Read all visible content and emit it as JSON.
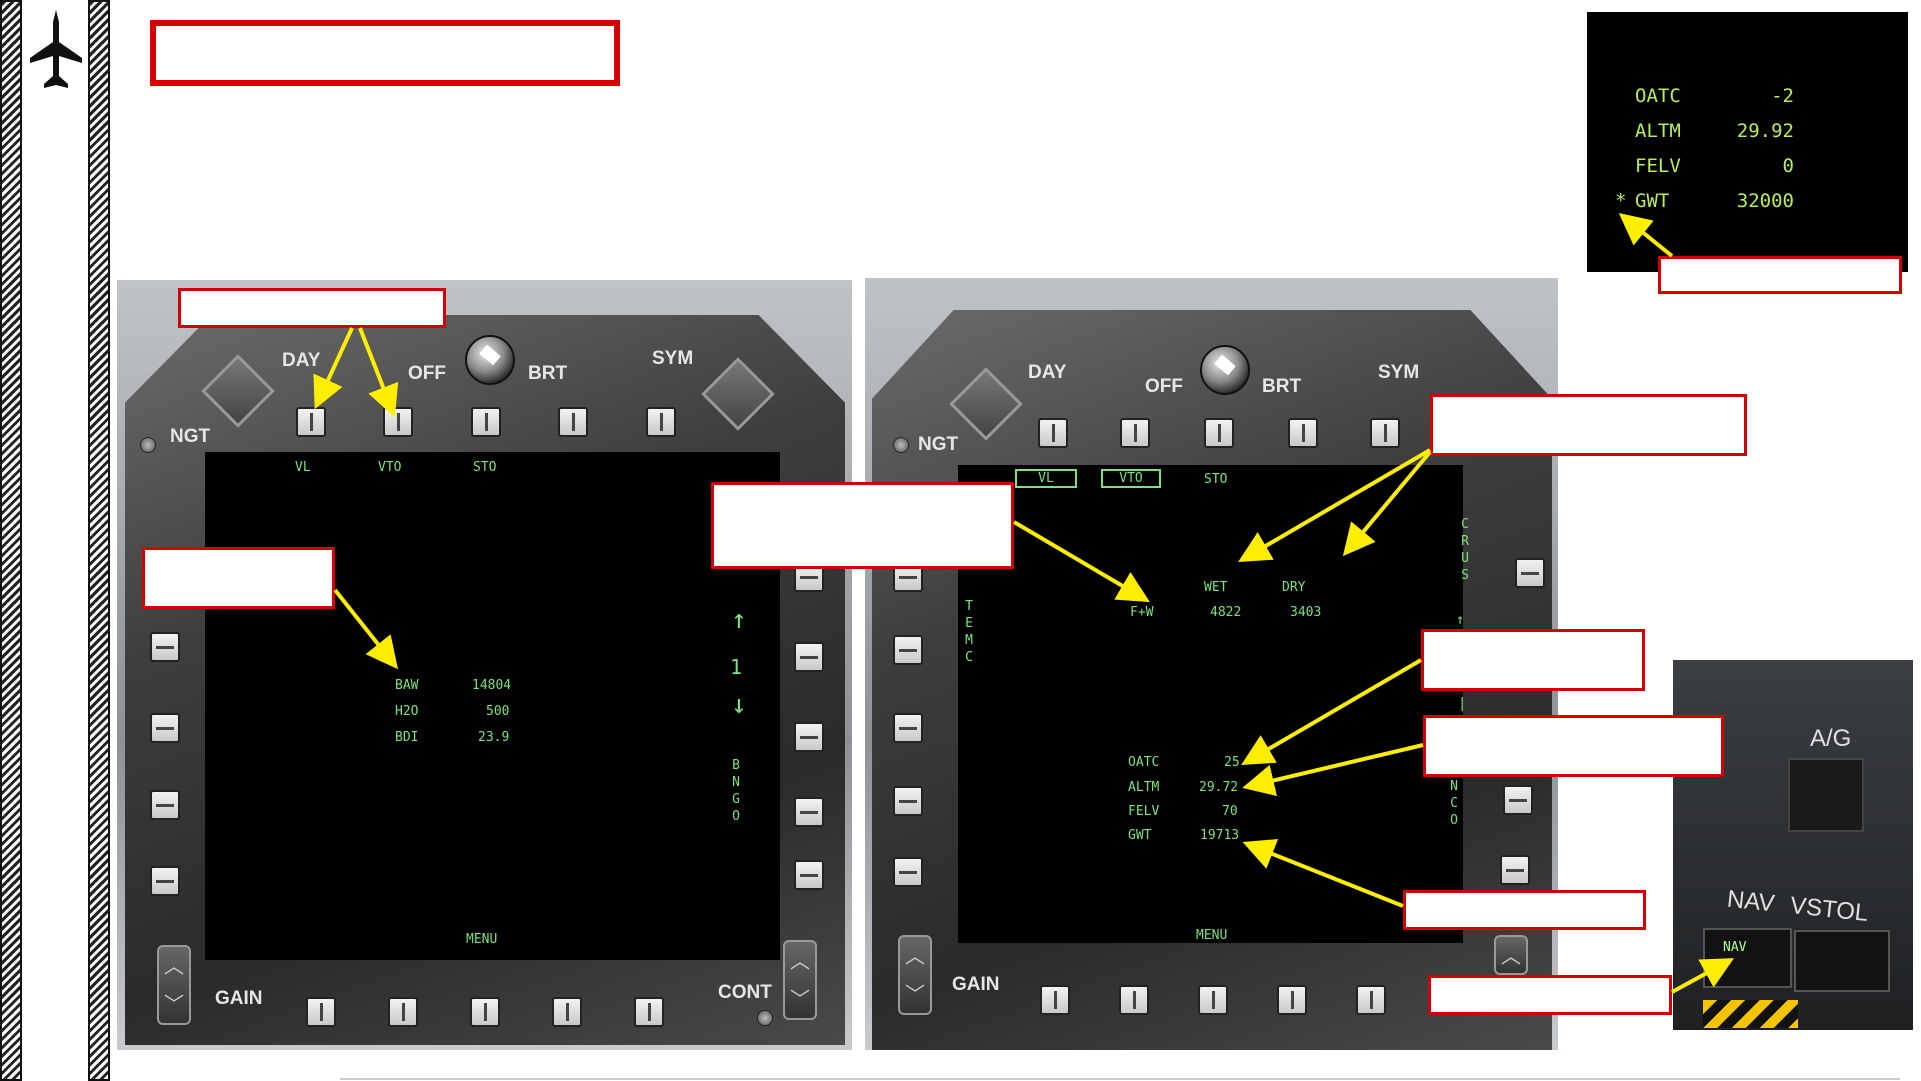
{
  "left_mfcd": {
    "bezel_labels": {
      "day": "DAY",
      "ngt": "NGT",
      "off": "OFF",
      "brt": "BRT",
      "sym": "SYM",
      "gain": "GAIN",
      "cont": "CONT"
    },
    "top_options": [
      "VL",
      "VTO",
      "STO"
    ],
    "table": [
      {
        "label": "BAW",
        "value": "14804"
      },
      {
        "label": "H2O",
        "value": "500"
      },
      {
        "label": "BDI",
        "value": "23.9"
      }
    ],
    "right_side": {
      "up_arrow": "↑",
      "page": "1",
      "down_arrow": "↓",
      "bngo": "BNGO"
    },
    "menu": "MENU"
  },
  "right_mfcd": {
    "bezel_labels": {
      "day": "DAY",
      "ngt": "NGT",
      "off": "OFF",
      "brt": "BRT",
      "sym": "SYM",
      "gain": "GAIN"
    },
    "top_options": [
      "VL",
      "VTO",
      "STO"
    ],
    "left_vertical": "TEMC",
    "right_vertical_top": "CRUS",
    "right_vertical_bottom": "NCO",
    "fuel_table": {
      "headers": [
        "WET",
        "DRY"
      ],
      "row_label": "F+W",
      "wet": "4822",
      "dry": "3403"
    },
    "params": [
      {
        "label": "OATC",
        "value": "25"
      },
      {
        "label": "ALTM",
        "value": "29.72"
      },
      {
        "label": "FELV",
        "value": "70"
      },
      {
        "label": "GWT",
        "value": "19713"
      }
    ],
    "menu": "MENU"
  },
  "info_panel": {
    "rows": [
      {
        "label": "OATC",
        "value": "-2"
      },
      {
        "label": "ALTM",
        "value": "29.92"
      },
      {
        "label": "FELV",
        "value": "0"
      },
      {
        "label": "GWT",
        "value": "32000",
        "marker": "*"
      }
    ]
  },
  "switch_panel": {
    "ag": "A/G",
    "nav": "NAV",
    "vstol": "VSTOL",
    "nav_light": "NAV"
  },
  "colors": {
    "callout_border": "#d40000",
    "arrow": "#ffee00",
    "mfd_text": "#7ee07e"
  }
}
